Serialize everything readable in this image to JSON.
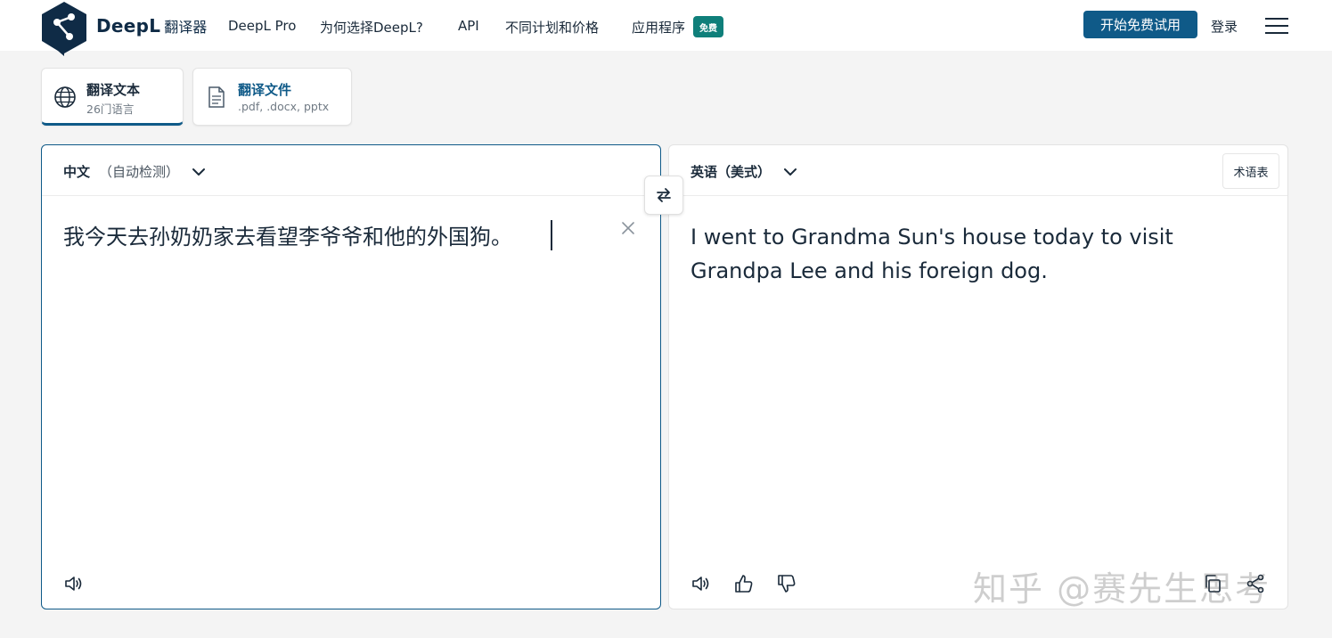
{
  "header": {
    "brand_name": "DeepL",
    "brand_sub": "翻译器",
    "nav": {
      "pro": "DeepL Pro",
      "why": "为何选择DeepL?",
      "api": "API",
      "plans": "不同计划和价格",
      "apps": "应用程序",
      "apps_badge": "免费"
    },
    "cta_label": "开始免费试用",
    "login_label": "登录"
  },
  "tabs": {
    "text": {
      "title": "翻译文本",
      "subtitle": "26门语言"
    },
    "file": {
      "title": "翻译文件",
      "subtitle": ".pdf, .docx, pptx"
    }
  },
  "source": {
    "language": "中文",
    "detect": "（自动检测）",
    "text": "我今天去孙奶奶家去看望李爷爷和他的外国狗。"
  },
  "target": {
    "language": "英语（美式）",
    "glossary_label": "术语表",
    "text": "I went to Grandma Sun's house today to visit Grandpa Lee and his foreign dog."
  },
  "watermark": "知乎 @赛先生思考",
  "colors": {
    "brand": "#0f2b46",
    "accent": "#0f5a88",
    "badge": "#0f7f7a"
  },
  "icons": [
    "deepl-logo-icon",
    "globe-icon",
    "document-icon",
    "chevron-down-icon",
    "swap-icon",
    "close-icon",
    "speaker-icon",
    "thumbs-up-icon",
    "thumbs-down-icon",
    "copy-icon",
    "share-icon",
    "menu-icon"
  ]
}
